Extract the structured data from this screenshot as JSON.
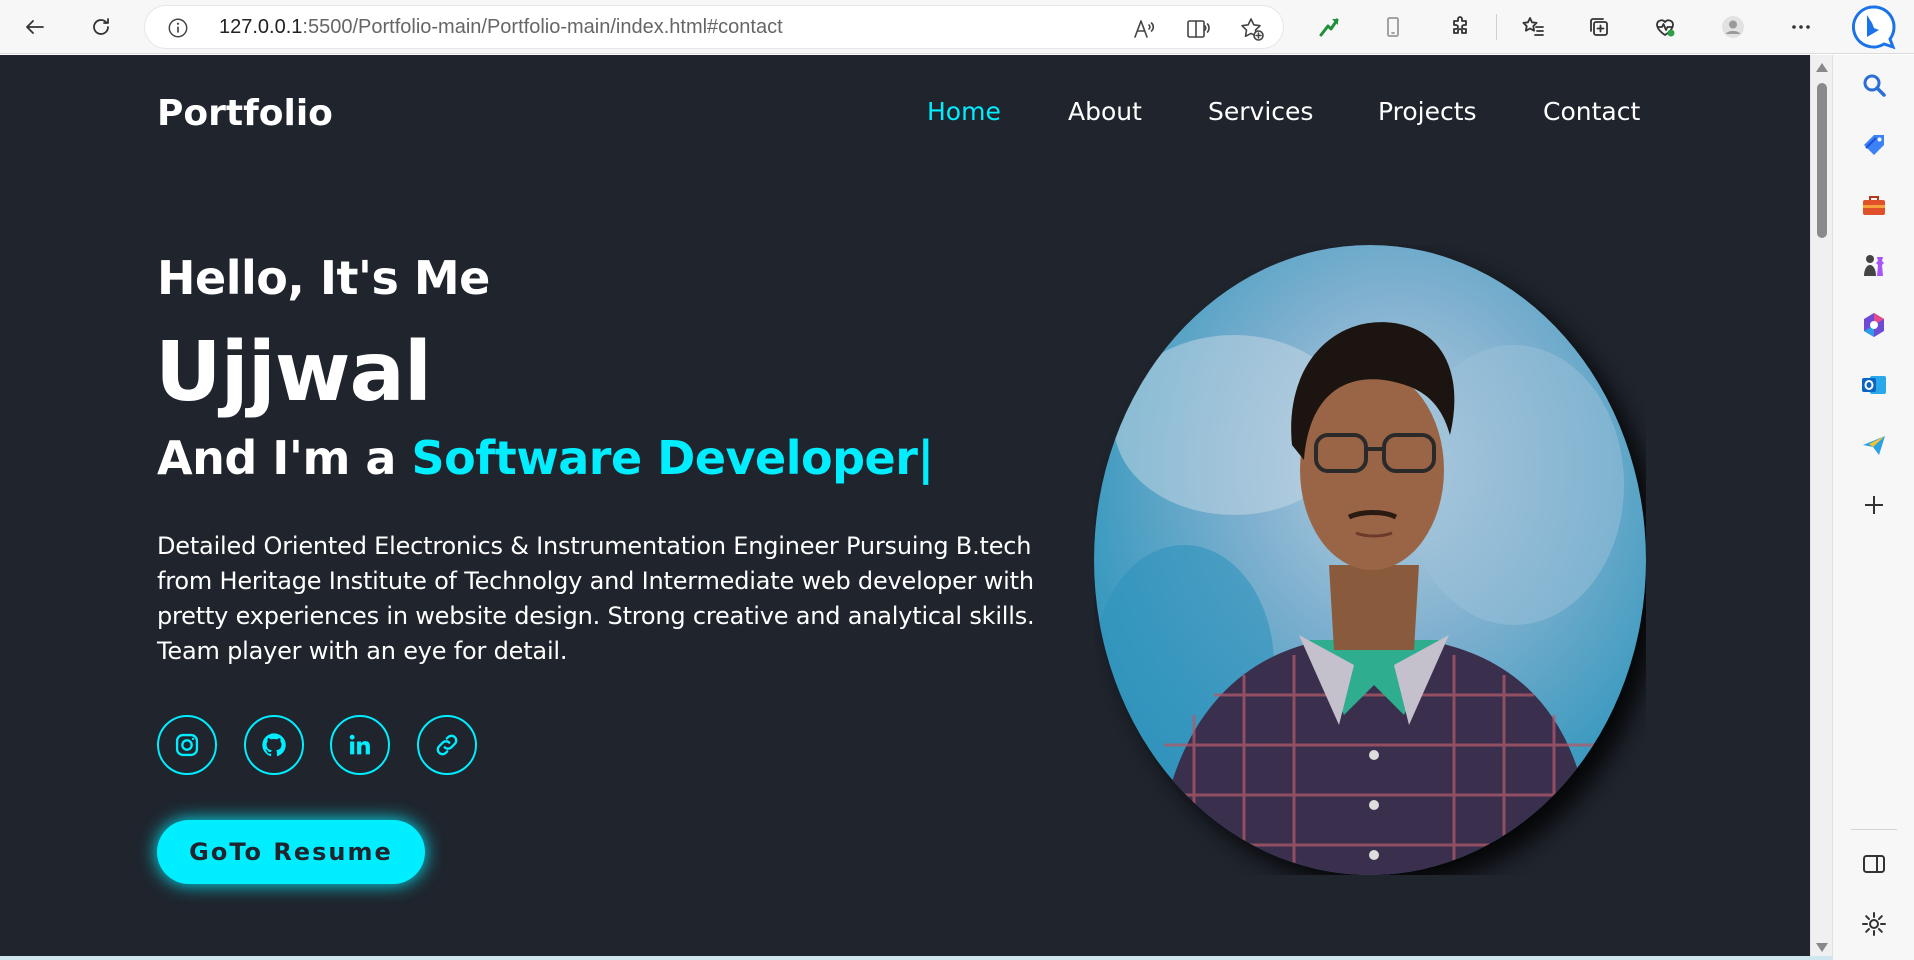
{
  "browser": {
    "url_host": "127.0.0.1",
    "url_rest": ":5500/Portfolio-main/Portfolio-main/index.html#contact",
    "icons": [
      "back-icon",
      "refresh-icon",
      "site-info-icon",
      "read-aloud-icon",
      "immersive-reader-icon",
      "add-favorite-icon",
      "extension-arrow-icon",
      "device-icon",
      "extensions-icon",
      "favorites-icon",
      "collections-icon",
      "browser-essentials-icon",
      "profile-icon",
      "more-icon",
      "bing-copilot-icon"
    ]
  },
  "page": {
    "logo": "Portfolio",
    "nav": [
      {
        "label": "Home",
        "active": true
      },
      {
        "label": "About",
        "active": false
      },
      {
        "label": "Services",
        "active": false
      },
      {
        "label": "Projects",
        "active": false
      },
      {
        "label": "Contact",
        "active": false
      }
    ],
    "hello": "Hello, It's Me",
    "name": "Ujjwal",
    "role_prefix": "And I'm a ",
    "role_accent": "Software Developer",
    "role_cursor": "|",
    "description": "Detailed Oriented Electronics & Instrumentation Engineer Pursuing B.tech from Heritage Institute of Technolgy and Intermediate web developer with pretty experiences in website design. Strong creative and analytical skills. Team player with an eye for detail.",
    "socials": [
      "instagram-icon",
      "github-icon",
      "linkedin-icon",
      "link-icon"
    ],
    "resume_button": "GoTo Resume"
  },
  "sidebar": {
    "items": [
      "search-icon",
      "shopping-tag-icon",
      "tools-icon",
      "games-icon",
      "office-icon",
      "outlook-icon",
      "send-icon",
      "add-icon",
      "sidebar-toggle-icon",
      "settings-icon"
    ]
  },
  "colors": {
    "accent": "#00eeff",
    "background": "#1f242d",
    "text": "#ffffff"
  }
}
